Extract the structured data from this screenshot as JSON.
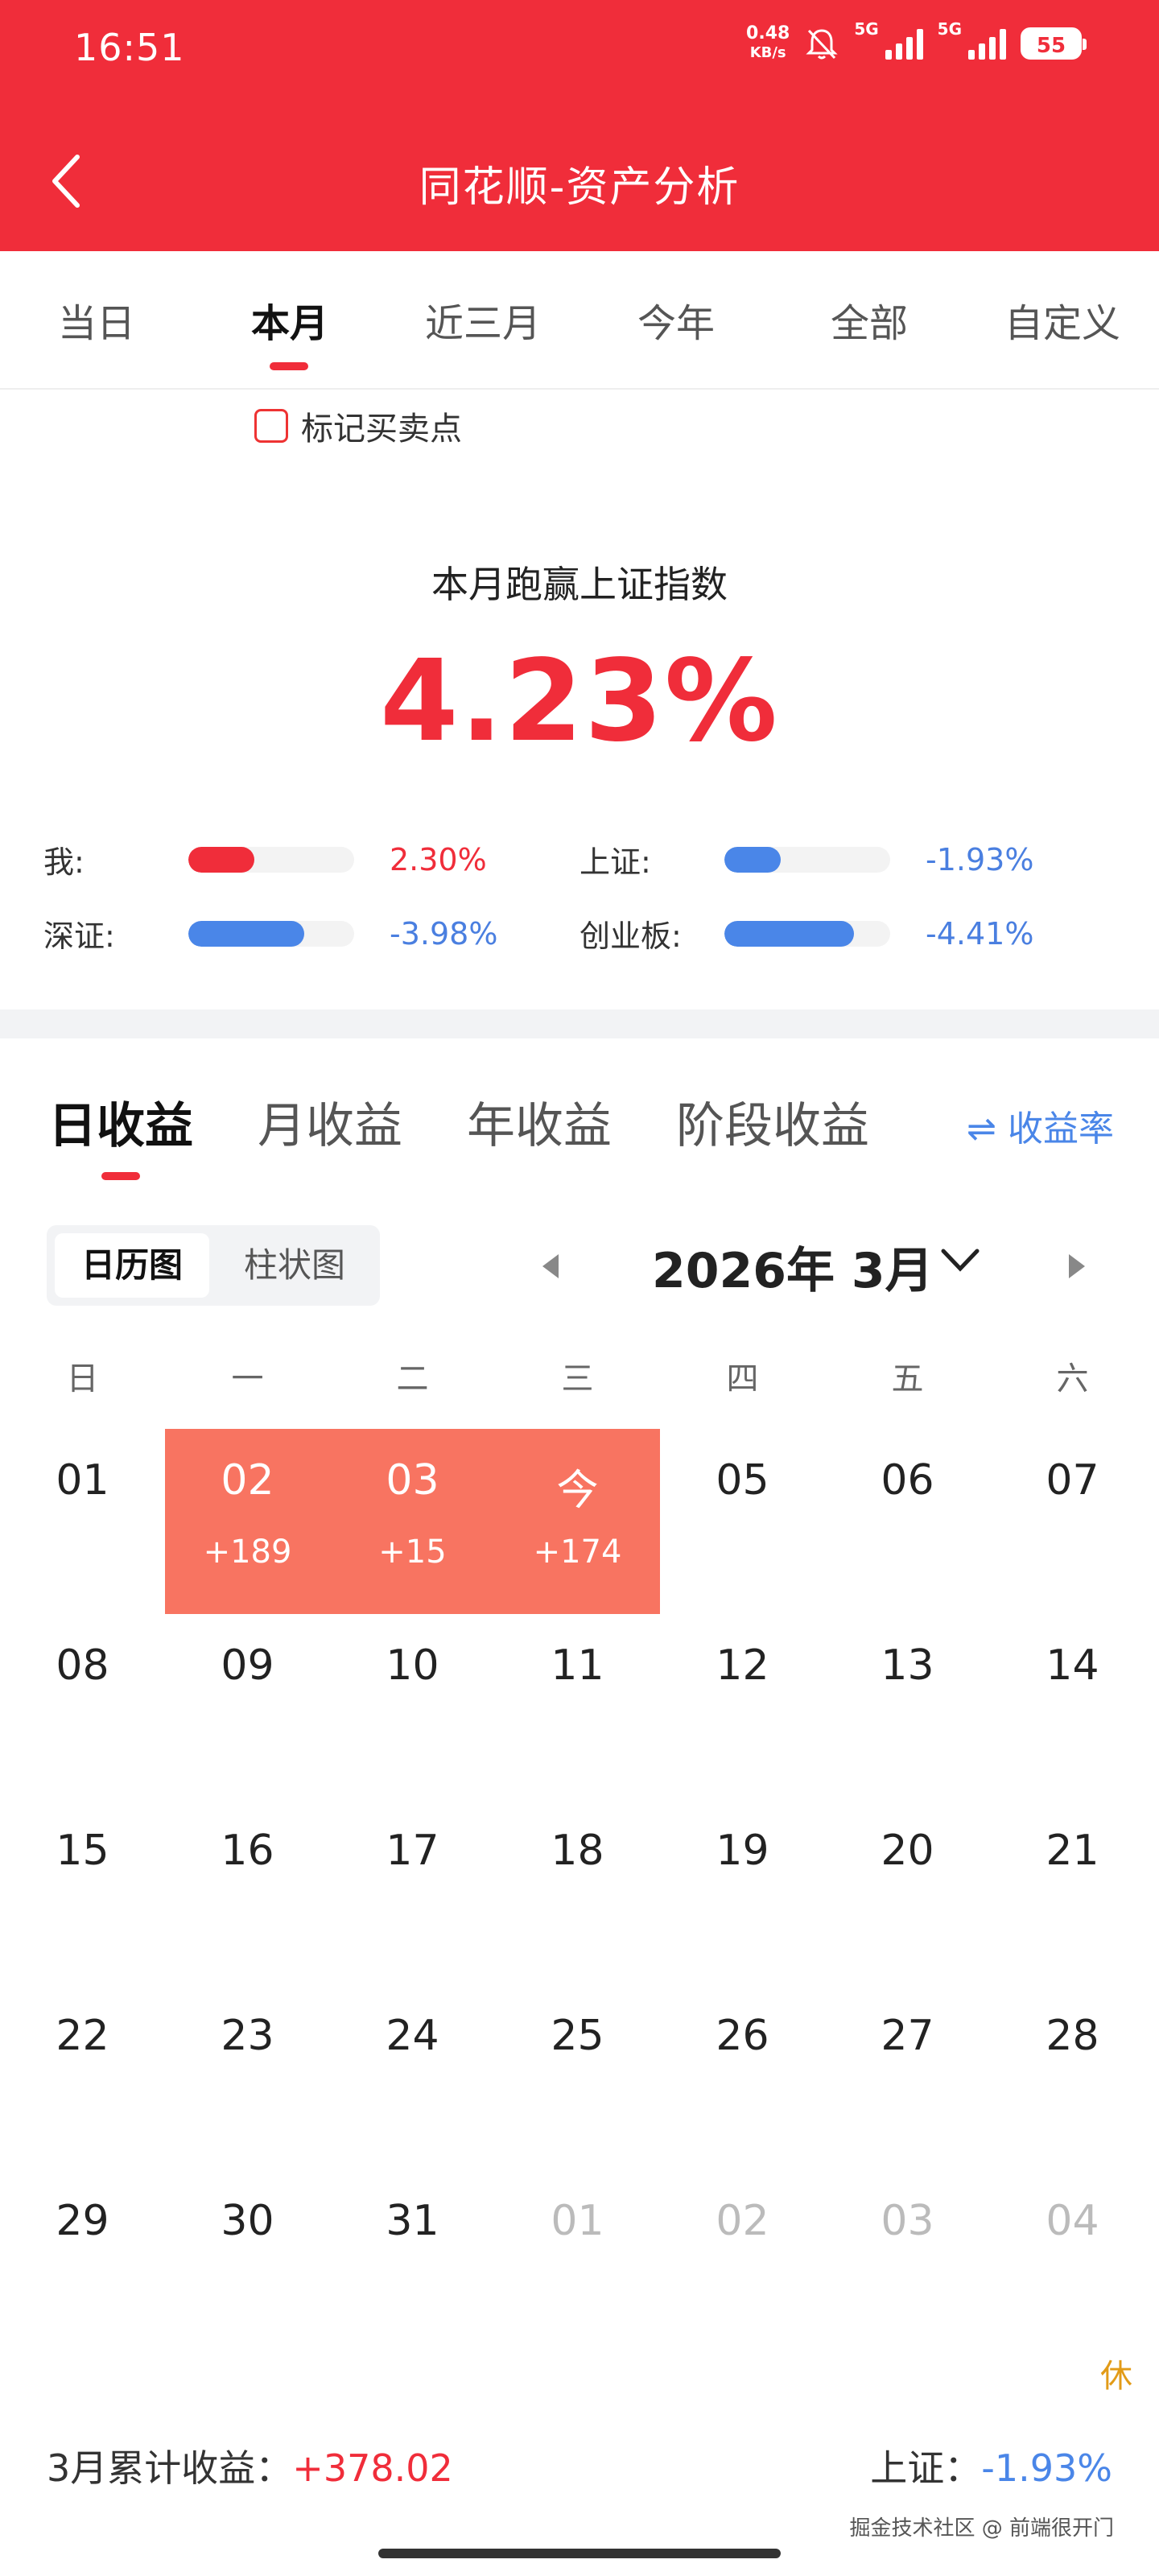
{
  "status": {
    "time": "16:51",
    "speed_top": "0.48",
    "speed_bottom": "KB/s",
    "net1": "5G",
    "net2": "5G",
    "battery": "55"
  },
  "header": {
    "title": "同花顺-资产分析"
  },
  "period_tabs": [
    {
      "label": "当日",
      "active": false
    },
    {
      "label": "本月",
      "active": true
    },
    {
      "label": "近三月",
      "active": false
    },
    {
      "label": "今年",
      "active": false
    },
    {
      "label": "全部",
      "active": false
    },
    {
      "label": "自定义",
      "active": false
    }
  ],
  "mark_points": {
    "label": "标记买卖点",
    "checked": false
  },
  "summary": {
    "label": "本月跑赢上证指数",
    "value": "4.23%"
  },
  "comparison": [
    {
      "name": "我:",
      "value": "2.30%",
      "fill": 0.4,
      "color": "#f02d3a"
    },
    {
      "name": "上证:",
      "value": "-1.93%",
      "fill": 0.34,
      "color": "#4a86e8"
    },
    {
      "name": "深证:",
      "value": "-3.98%",
      "fill": 0.7,
      "color": "#4a86e8"
    },
    {
      "name": "创业板:",
      "value": "-4.41%",
      "fill": 0.78,
      "color": "#4a86e8"
    }
  ],
  "income_tabs": [
    {
      "label": "日收益",
      "active": true
    },
    {
      "label": "月收益",
      "active": false
    },
    {
      "label": "年收益",
      "active": false
    },
    {
      "label": "阶段收益",
      "active": false
    }
  ],
  "rate_toggle": {
    "label": "⇌ 收益率"
  },
  "view_toggle": {
    "calendar": "日历图",
    "bar": "柱状图"
  },
  "month_label": "2026年 3月",
  "weekdays": [
    "日",
    "一",
    "二",
    "三",
    "四",
    "五",
    "六"
  ],
  "calendar_weeks": [
    [
      {
        "d": "01"
      },
      {
        "d": "02",
        "p": "+189"
      },
      {
        "d": "03",
        "p": "+15"
      },
      {
        "d": "今",
        "p": "+174"
      },
      {
        "d": "05"
      },
      {
        "d": "06"
      },
      {
        "d": "07"
      }
    ],
    [
      {
        "d": "08"
      },
      {
        "d": "09"
      },
      {
        "d": "10"
      },
      {
        "d": "11"
      },
      {
        "d": "12"
      },
      {
        "d": "13"
      },
      {
        "d": "14"
      }
    ],
    [
      {
        "d": "15"
      },
      {
        "d": "16"
      },
      {
        "d": "17"
      },
      {
        "d": "18"
      },
      {
        "d": "19"
      },
      {
        "d": "20"
      },
      {
        "d": "21"
      }
    ],
    [
      {
        "d": "22"
      },
      {
        "d": "23"
      },
      {
        "d": "24"
      },
      {
        "d": "25"
      },
      {
        "d": "26"
      },
      {
        "d": "27"
      },
      {
        "d": "28"
      }
    ],
    [
      {
        "d": "29"
      },
      {
        "d": "30"
      },
      {
        "d": "31"
      },
      {
        "d": "01",
        "o": true
      },
      {
        "d": "02",
        "o": true
      },
      {
        "d": "03",
        "o": true
      },
      {
        "d": "04",
        "o": true,
        "r": "休"
      }
    ]
  ],
  "footer": {
    "cum_label": "3月累计收益：",
    "cum_value": "+378.02",
    "index_label": "上证：",
    "index_value": "-1.93%"
  },
  "watermark": "掘金技术社区 @ 前端很开门"
}
